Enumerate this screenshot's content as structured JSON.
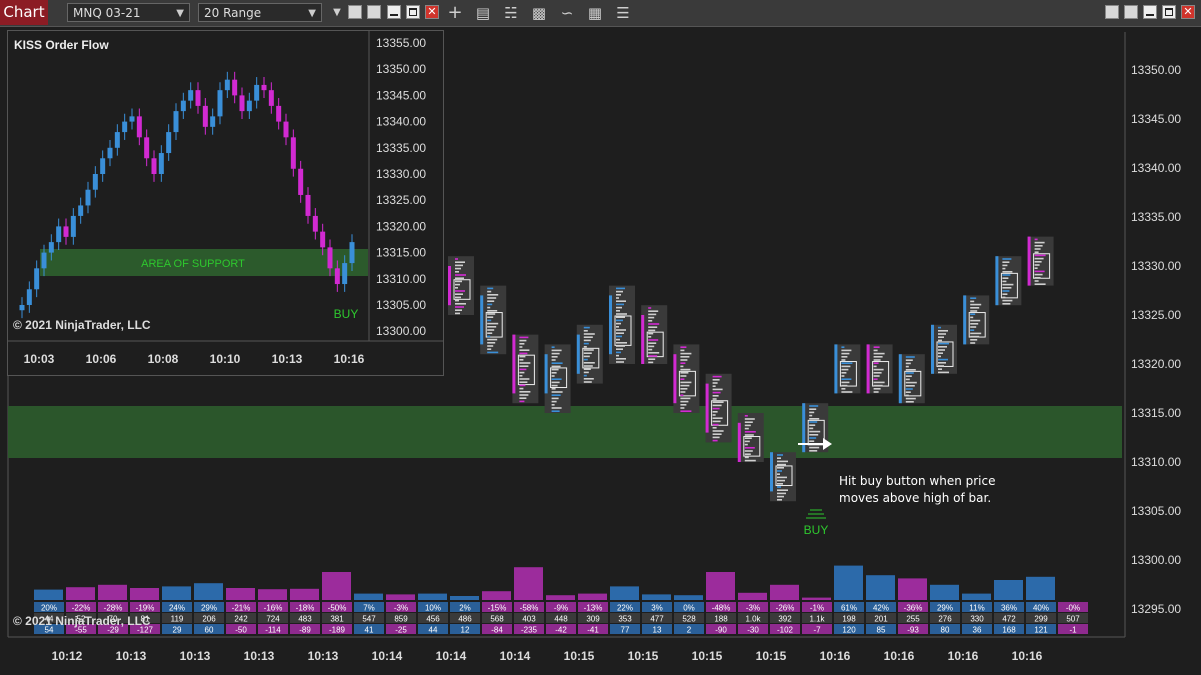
{
  "toolbar": {
    "tab_label": "Chart",
    "instrument": "MNQ 03-21",
    "bar_type": "20 Range",
    "icons": [
      "crosshair-icon",
      "data-box-icon",
      "bar-type-icon",
      "indicators-icon",
      "strategies-icon",
      "properties-icon",
      "list-icon"
    ]
  },
  "colors": {
    "up": "#3a8fd8",
    "down": "#d22ad2",
    "support": "#2c5a2c",
    "buy": "#2ec82e"
  },
  "annotation": {
    "line1": "Hit buy button when price",
    "line2": "moves above high of bar."
  },
  "main_chart": {
    "copyright": "© 2021 NinjaTrader, LLC",
    "buy_label": "BUY",
    "y_ticks": [
      "13350.00",
      "13345.00",
      "13340.00",
      "13335.00",
      "13330.00",
      "13325.00",
      "13320.00",
      "13315.00",
      "13310.00",
      "13305.00",
      "13300.00",
      "13295.00"
    ],
    "x_ticks": [
      "10:12",
      "10:13",
      "10:13",
      "10:13",
      "10:13",
      "10:14",
      "10:14",
      "10:14",
      "10:15",
      "10:15",
      "10:15",
      "10:15",
      "10:16",
      "10:16",
      "10:16",
      "10:16"
    ],
    "bars": [
      {
        "d": -1,
        "o": 13330,
        "c": 13326,
        "h": 13331,
        "l": 13325
      },
      {
        "d": 1,
        "o": 13322,
        "c": 13327,
        "h": 13328,
        "l": 13321
      },
      {
        "d": -1,
        "o": 13323,
        "c": 13317,
        "h": 13323,
        "l": 13316
      },
      {
        "d": 1,
        "o": 13317,
        "c": 13321,
        "h": 13322,
        "l": 13315
      },
      {
        "d": 1,
        "o": 13319,
        "c": 13323,
        "h": 13324,
        "l": 13318
      },
      {
        "d": 1,
        "o": 13321,
        "c": 13327,
        "h": 13328,
        "l": 13320
      },
      {
        "d": -1,
        "o": 13325,
        "c": 13320,
        "h": 13326,
        "l": 13320
      },
      {
        "d": -1,
        "o": 13321,
        "c": 13316,
        "h": 13322,
        "l": 13315
      },
      {
        "d": -1,
        "o": 13318,
        "c": 13313,
        "h": 13319,
        "l": 13312
      },
      {
        "d": -1,
        "o": 13314,
        "c": 13310,
        "h": 13315,
        "l": 13310
      },
      {
        "d": 1,
        "o": 13307,
        "c": 13311,
        "h": 13311,
        "l": 13306
      },
      {
        "d": 1,
        "o": 13311,
        "c": 13316,
        "h": 13316,
        "l": 13311
      },
      {
        "d": 1,
        "o": 13317,
        "c": 13322,
        "h": 13322,
        "l": 13317
      },
      {
        "d": -1,
        "o": 13322,
        "c": 13317,
        "h": 13322,
        "l": 13317
      },
      {
        "d": 1,
        "o": 13316,
        "c": 13321,
        "h": 13321,
        "l": 13316
      },
      {
        "d": 1,
        "o": 13319,
        "c": 13324,
        "h": 13324,
        "l": 13319
      },
      {
        "d": 1,
        "o": 13322,
        "c": 13327,
        "h": 13327,
        "l": 13322
      },
      {
        "d": 1,
        "o": 13326,
        "c": 13331,
        "h": 13331,
        "l": 13326
      },
      {
        "d": -1,
        "o": 13333,
        "c": 13328,
        "h": 13333,
        "l": 13328
      }
    ],
    "delta_pct": [
      [
        "20%",
        "-22%",
        "-28%",
        "-19%",
        "24%",
        "29%",
        "-21%",
        "-16%",
        "-18%",
        "-50%",
        "7%",
        "-3%",
        "10%",
        "2%",
        "-15%",
        "-58%",
        "-9%",
        "-13%",
        "22%",
        "3%",
        "0%",
        "-48%",
        "-3%",
        "-26%",
        "-1%",
        "61%",
        "42%",
        "-36%",
        "29%",
        "11%",
        "36%",
        "40%",
        "-0%"
      ]
    ],
    "volume_row": [
      "44",
      "52",
      "70",
      "81",
      "119",
      "206",
      "242",
      "724",
      "483",
      "381",
      "547",
      "859",
      "456",
      "486",
      "568",
      "403",
      "448",
      "309",
      "353",
      "477",
      "528",
      "188",
      "1.0k",
      "392",
      "1.1k",
      "198",
      "201",
      "255",
      "276",
      "330",
      "472",
      "299",
      "507"
    ],
    "delta_row": [
      "54",
      "-55",
      "-29",
      "-127",
      "29",
      "60",
      "-50",
      "-114",
      "-89",
      "-189",
      "41",
      "-25",
      "44",
      "12",
      "-84",
      "-235",
      "-42",
      "-41",
      "77",
      "13",
      "2",
      "-90",
      "-30",
      "-102",
      "-7",
      "120",
      "85",
      "-93",
      "80",
      "36",
      "168",
      "121",
      "-1"
    ],
    "vol_heights": [
      0.26,
      0.32,
      0.38,
      0.3,
      0.34,
      0.42,
      0.3,
      0.27,
      0.28,
      0.7,
      0.16,
      0.14,
      0.16,
      0.1,
      0.22,
      0.82,
      0.12,
      0.16,
      0.34,
      0.14,
      0.12,
      0.7,
      0.18,
      0.38,
      0.06,
      0.86,
      0.62,
      0.54,
      0.38,
      0.16,
      0.5,
      0.58,
      0.0
    ]
  },
  "inset_chart": {
    "title": "KISS Order Flow",
    "support_label": "AREA OF SUPPORT",
    "buy_label": "BUY",
    "copyright": "© 2021 NinjaTrader, LLC",
    "y_ticks": [
      "13355.00",
      "13350.00",
      "13345.00",
      "13340.00",
      "13335.00",
      "13330.00",
      "13325.00",
      "13320.00",
      "13315.00",
      "13310.00",
      "13305.00",
      "13300.00"
    ],
    "x_ticks": [
      "10:03",
      "10:06",
      "10:08",
      "10:10",
      "10:13",
      "10:16"
    ]
  }
}
